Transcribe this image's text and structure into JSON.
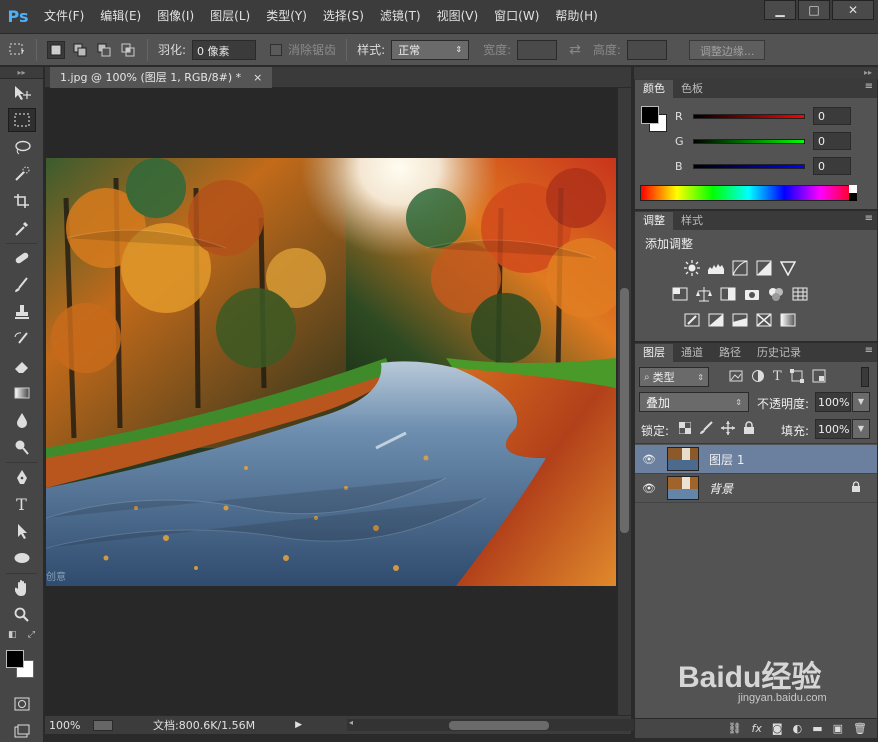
{
  "app": {
    "logo": "Ps",
    "menu": [
      "文件(F)",
      "编辑(E)",
      "图像(I)",
      "图层(L)",
      "类型(Y)",
      "选择(S)",
      "滤镜(T)",
      "视图(V)",
      "窗口(W)",
      "帮助(H)"
    ],
    "window_controls": [
      "minimize-icon",
      "maximize-icon",
      "close-icon"
    ]
  },
  "options": {
    "feather_label": "羽化:",
    "feather_value": "0 像素",
    "antialias_label": "消除锯齿",
    "style_label": "样式:",
    "style_value": "正常",
    "width_label": "宽度:",
    "height_label": "高度:",
    "refine_edge": "调整边缘..."
  },
  "document": {
    "tab_title": "1.jpg @ 100% (图层 1, RGB/8#) *",
    "tab_close": "×",
    "zoom": "100%",
    "doc_size": "文档:800.6K/1.56M",
    "watermark_text": "创意"
  },
  "color_panel": {
    "tabs": [
      "颜色",
      "色板"
    ],
    "r_label": "R",
    "r_value": "0",
    "g_label": "G",
    "g_value": "0",
    "b_label": "B",
    "b_value": "0",
    "foreground": "#000000",
    "background": "#ffffff"
  },
  "adjust_panel": {
    "tabs": [
      "调整",
      "样式"
    ],
    "heading": "添加调整",
    "icons": [
      "brightness-icon",
      "levels-icon",
      "curves-icon",
      "exposure-icon",
      "vibrance-icon",
      "hue-saturation-icon",
      "color-balance-icon",
      "black-white-icon",
      "photo-filter-icon",
      "channel-mixer-icon",
      "color-lookup-icon",
      "invert-icon",
      "posterize-icon",
      "threshold-icon",
      "selective-color-icon",
      "gradient-map-icon"
    ]
  },
  "layers_panel": {
    "tabs": [
      "图层",
      "通道",
      "路径",
      "历史记录"
    ],
    "filter_label": "类型",
    "blend_mode": "叠加",
    "opacity_label": "不透明度:",
    "opacity_value": "100%",
    "lock_label": "锁定:",
    "fill_label": "填充:",
    "fill_value": "100%",
    "layers": [
      {
        "name": "图层 1",
        "selected": true
      },
      {
        "name": "背景",
        "selected": false,
        "locked": true
      }
    ]
  },
  "watermark": {
    "text": "Baidu经验",
    "subtext": "jingyan.baidu.com"
  }
}
